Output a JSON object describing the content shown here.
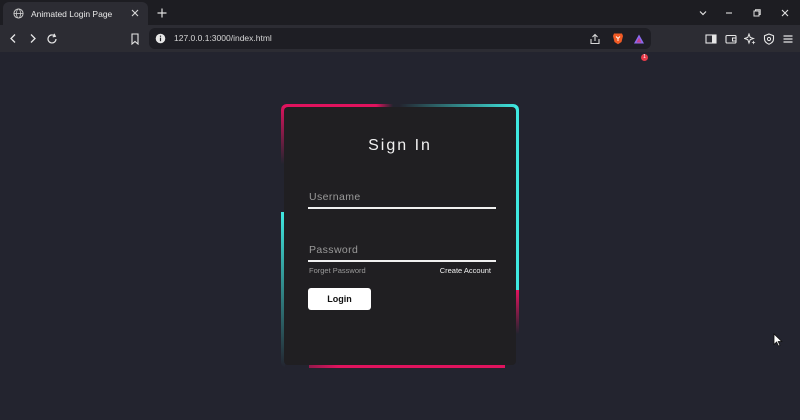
{
  "browser": {
    "tab_title": "Animated Login Page",
    "url": "127.0.0.1:3000/index.html",
    "shield_badge": "1"
  },
  "login": {
    "title": "Sign In",
    "username_placeholder": "Username",
    "password_placeholder": "Password",
    "forget_password": "Forget Password",
    "create_account": "Create Account",
    "login_button": "Login"
  },
  "colors": {
    "page_bg": "#23242f",
    "card_bg": "#201f22",
    "accent_pink": "#e0135e",
    "accent_cyan": "#3fe8e0"
  },
  "icons": {
    "tab": "globe-icon",
    "toolbar_left": [
      "back-icon",
      "forward-icon",
      "reload-icon",
      "bookmark-icon",
      "site-info-icon"
    ],
    "toolbar_right": [
      "share-icon",
      "brave-shields-icon",
      "brave-rewards-icon",
      "sidebar-icon",
      "wallet-icon",
      "leo-ai-icon",
      "vpn-icon",
      "menu-icon"
    ]
  }
}
